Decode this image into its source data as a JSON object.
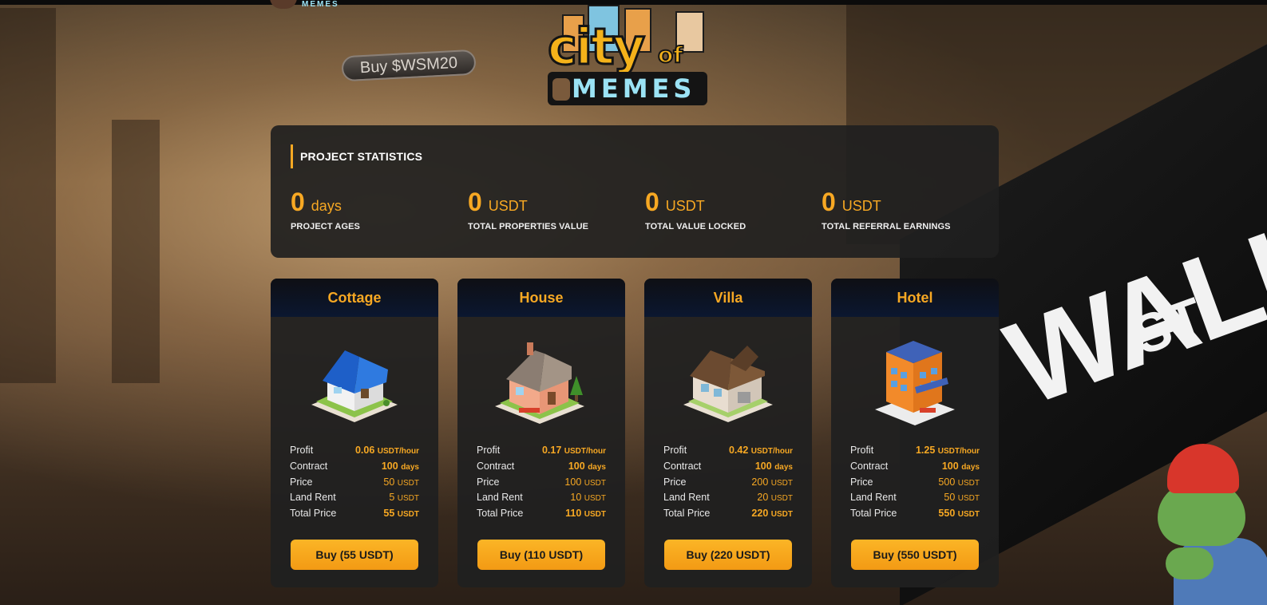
{
  "header": {
    "mini_logo_text": "MEMES",
    "logo_city": "city",
    "logo_of": "of",
    "logo_memes": "MEMES"
  },
  "background": {
    "street_sign": "Buy  $WSM20",
    "wall_st_main": "WALL",
    "wall_st_sup": "ST"
  },
  "stats": {
    "title": "PROJECT STATISTICS",
    "items": [
      {
        "value": "0",
        "unit": "days",
        "label": "PROJECT AGES"
      },
      {
        "value": "0",
        "unit": "USDT",
        "label": "TOTAL PROPERTIES VALUE"
      },
      {
        "value": "0",
        "unit": "USDT",
        "label": "TOTAL VALUE LOCKED"
      },
      {
        "value": "0",
        "unit": "USDT",
        "label": "TOTAL REFERRAL EARNINGS"
      }
    ]
  },
  "labels": {
    "profit": "Profit",
    "contract": "Contract",
    "price": "Price",
    "land_rent": "Land Rent",
    "total_price": "Total Price",
    "unit_usdt": "USDT",
    "unit_rate": "USDT/hour",
    "unit_days": "days"
  },
  "properties": [
    {
      "name": "Cottage",
      "icon": "cottage-icon",
      "profit": "0.06",
      "contract": "100",
      "price": "50",
      "land_rent": "5",
      "total": "55",
      "buy_label": "Buy (55 USDT)"
    },
    {
      "name": "House",
      "icon": "house-icon",
      "profit": "0.17",
      "contract": "100",
      "price": "100",
      "land_rent": "10",
      "total": "110",
      "buy_label": "Buy (110 USDT)"
    },
    {
      "name": "Villa",
      "icon": "villa-icon",
      "profit": "0.42",
      "contract": "100",
      "price": "200",
      "land_rent": "20",
      "total": "220",
      "buy_label": "Buy (220 USDT)"
    },
    {
      "name": "Hotel",
      "icon": "hotel-icon",
      "profit": "1.25",
      "contract": "100",
      "price": "500",
      "land_rent": "50",
      "total": "550",
      "buy_label": "Buy (550 USDT)"
    }
  ],
  "colors": {
    "accent": "#f7a823",
    "panel": "#202020",
    "button": "#f5a418",
    "memes_text": "#9be3f5"
  }
}
